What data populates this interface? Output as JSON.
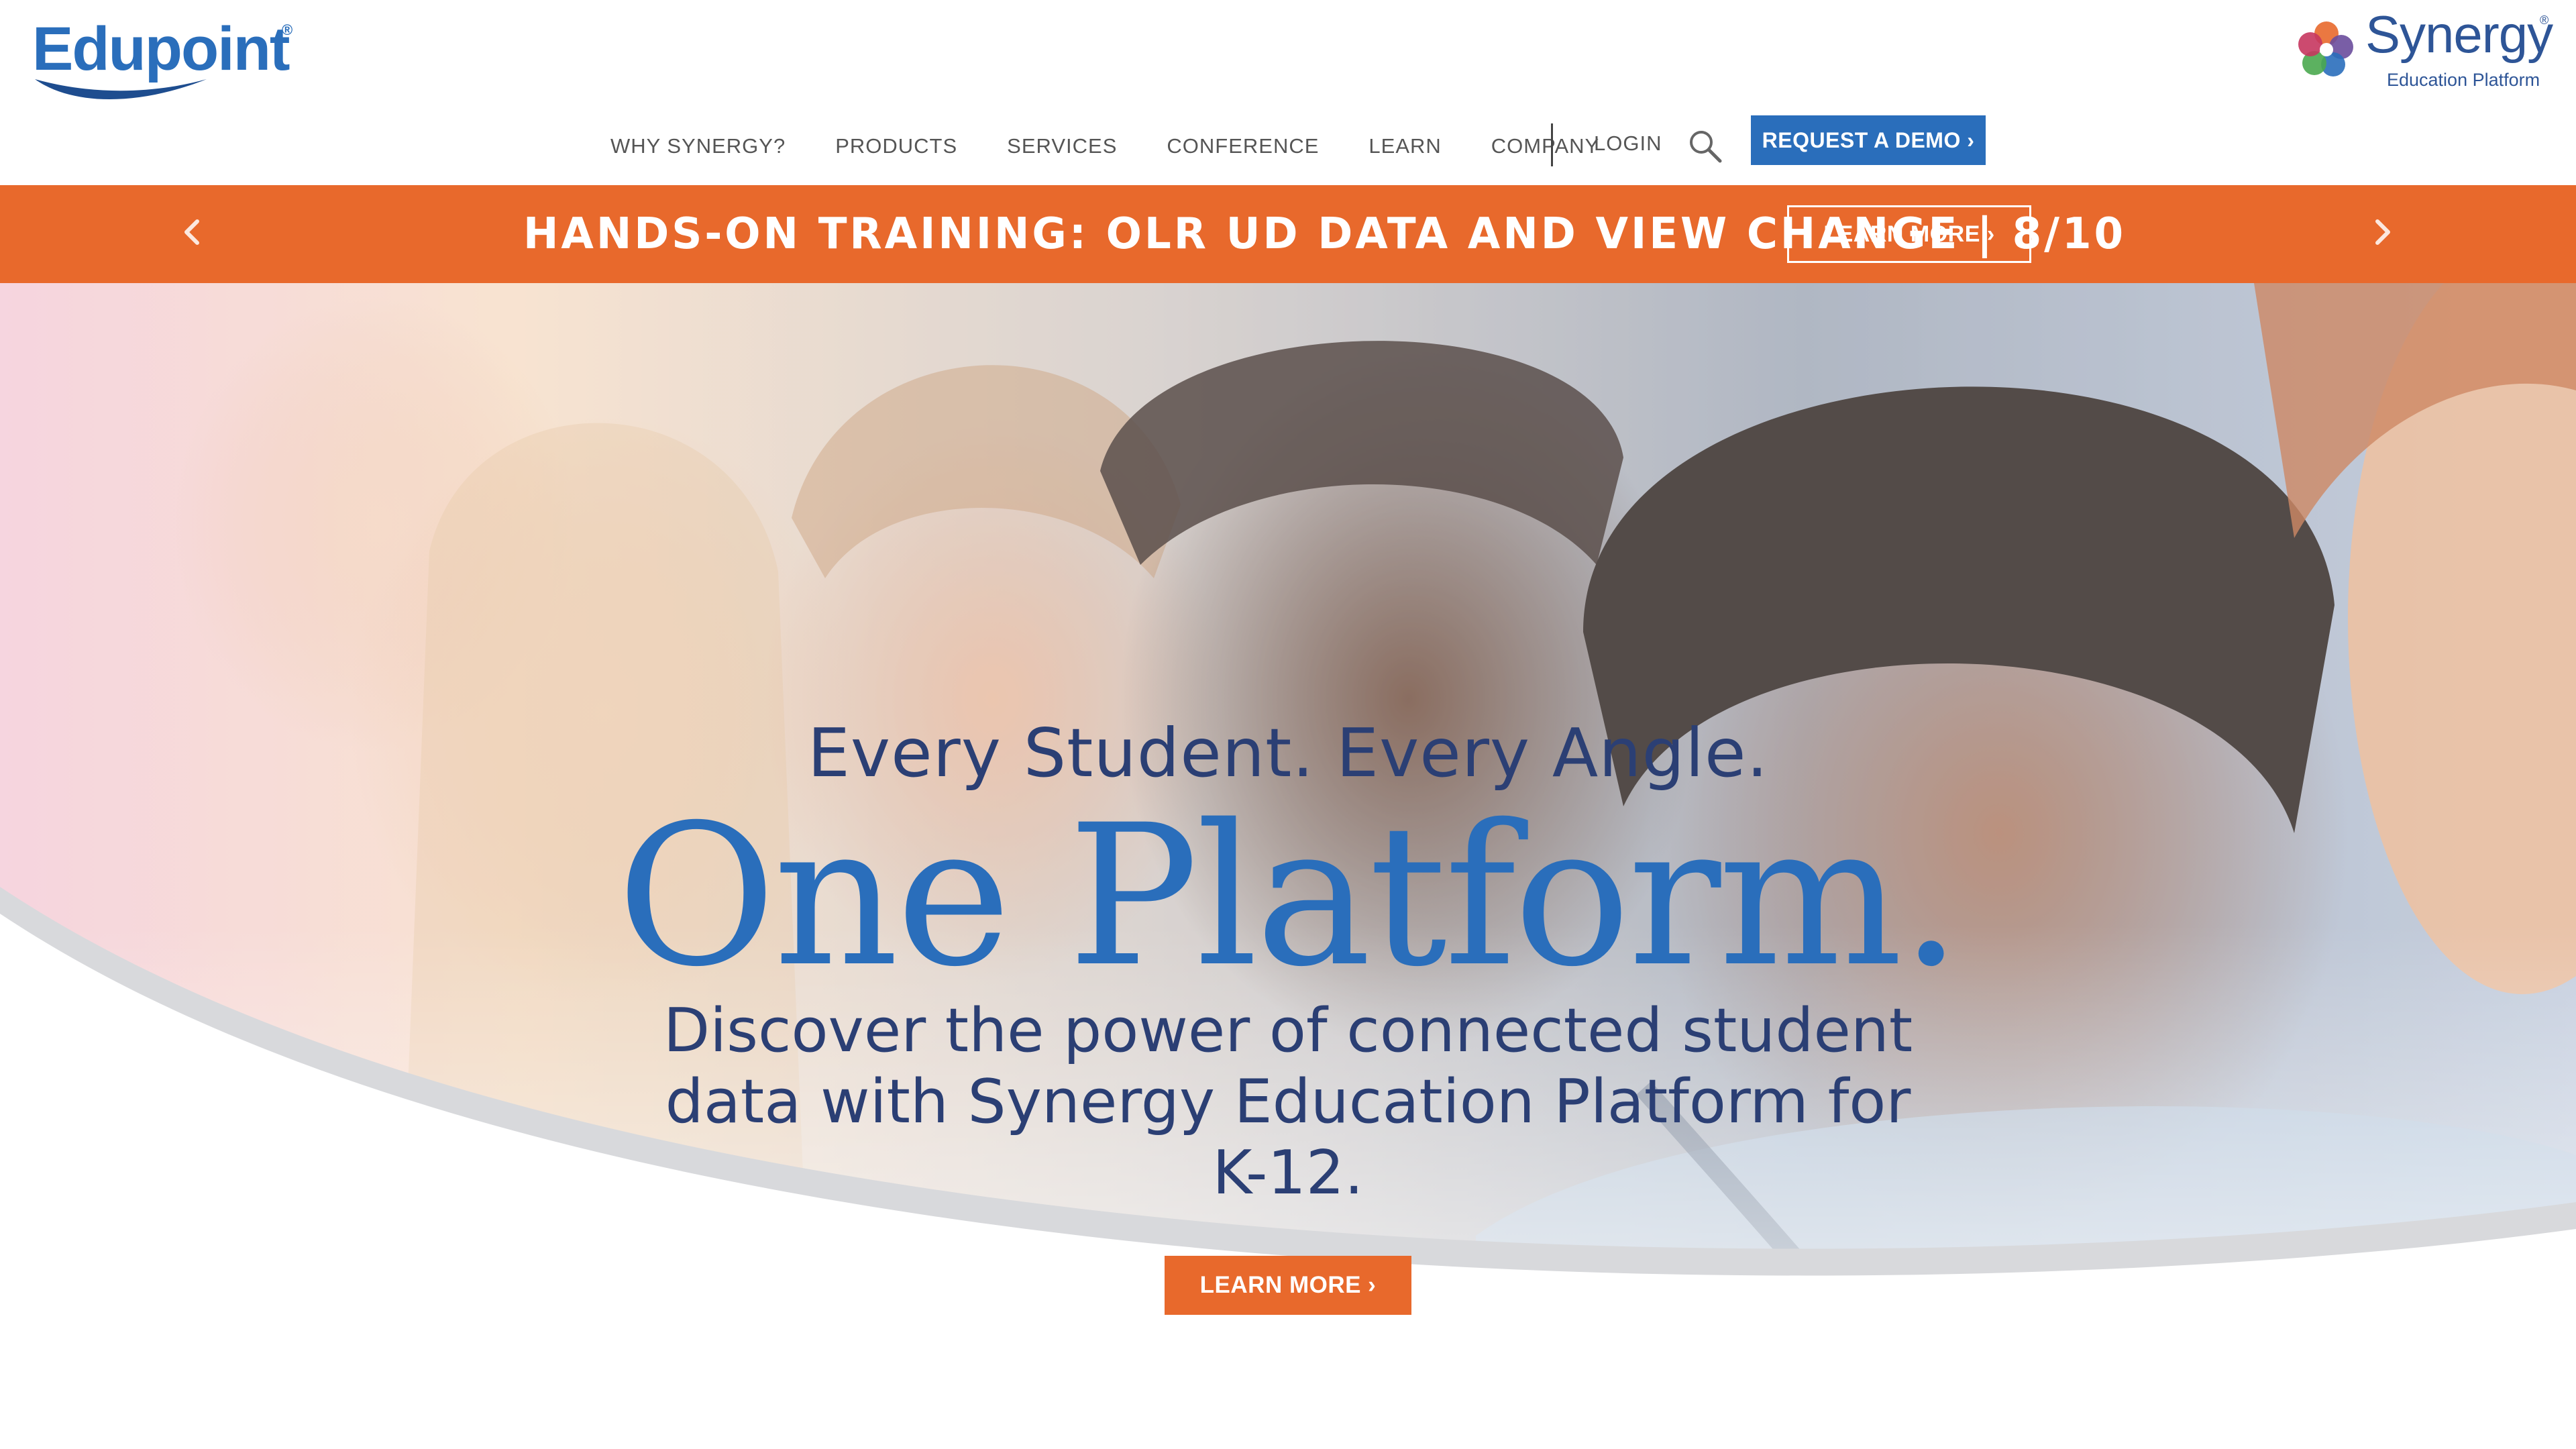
{
  "header": {
    "edupoint_logo": "Edupoint",
    "synergy_logo": {
      "name": "Synergy",
      "subtitle": "Education Platform"
    },
    "nav": [
      {
        "label": "WHY SYNERGY?"
      },
      {
        "label": "PRODUCTS"
      },
      {
        "label": "SERVICES"
      },
      {
        "label": "CONFERENCE"
      },
      {
        "label": "LEARN"
      },
      {
        "label": "COMPANY"
      }
    ],
    "login_label": "LOGIN",
    "search_icon": "search-icon",
    "demo_button_label": "REQUEST A DEMO ›"
  },
  "banner": {
    "text": "HANDS-ON TRAINING: OLR UD DATA AND VIEW CHANGE | 8/10",
    "button_label": "LEARN MORE ›",
    "prev_icon": "chevron-left-icon",
    "next_icon": "chevron-right-icon"
  },
  "hero": {
    "tagline": "Every Student. Every Angle.",
    "title": "One Platform.",
    "description": "Discover the power of connected student data with Synergy Education Platform for K-12.",
    "cta_label": "LEARN MORE ›"
  },
  "colors": {
    "brand_blue": "#2a6ebb",
    "navy": "#2b3f74",
    "orange": "#e8692c"
  }
}
